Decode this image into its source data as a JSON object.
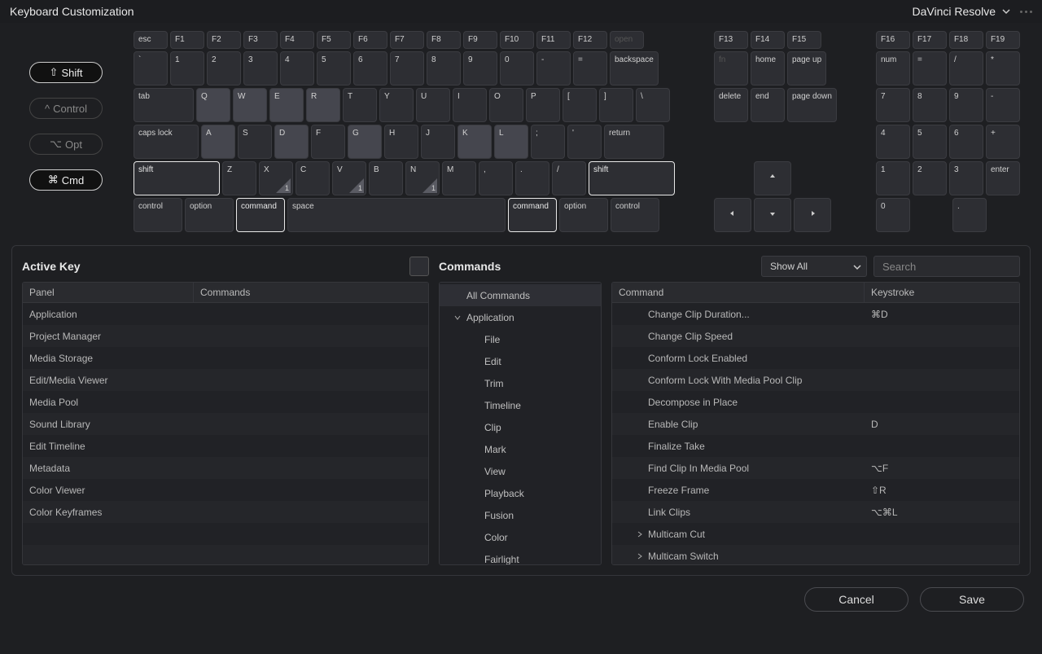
{
  "title": "Keyboard Customization",
  "preset": "DaVinci Resolve",
  "modifiers": [
    {
      "symbol": "⇧",
      "label": "Shift",
      "active": true
    },
    {
      "symbol": "^",
      "label": "Control",
      "active": false
    },
    {
      "symbol": "⌥",
      "label": "Opt",
      "active": false
    },
    {
      "symbol": "⌘",
      "label": "Cmd",
      "active": true
    }
  ],
  "keyboard": {
    "fn_row": [
      "esc",
      "F1",
      "F2",
      "F3",
      "F4",
      "F5",
      "F6",
      "F7",
      "F8",
      "F9",
      "F10",
      "F11",
      "F12"
    ],
    "open_key": "open",
    "num_row": [
      "`",
      "1",
      "2",
      "3",
      "4",
      "5",
      "6",
      "7",
      "8",
      "9",
      "0",
      "-",
      "=",
      "backspace"
    ],
    "q_row": [
      "tab",
      "Q",
      "W",
      "E",
      "R",
      "T",
      "Y",
      "U",
      "I",
      "O",
      "P",
      "[",
      "]",
      "\\"
    ],
    "a_row": [
      "caps lock",
      "A",
      "S",
      "D",
      "F",
      "G",
      "H",
      "J",
      "K",
      "L",
      ";",
      "'",
      "return"
    ],
    "z_row": [
      "shift",
      "Z",
      "X",
      "C",
      "V",
      "B",
      "N",
      "M",
      ",",
      ".",
      "/",
      "shift"
    ],
    "bottom_row": [
      "control",
      "option",
      "command",
      "space",
      "command",
      "option",
      "control"
    ],
    "nav_top": [
      "F13",
      "F14",
      "F15"
    ],
    "nav_mid1": [
      "fn",
      "home",
      "page up"
    ],
    "nav_mid2": [
      "delete",
      "end",
      "page down"
    ],
    "numpad_top": [
      "F16",
      "F17",
      "F18",
      "F19"
    ],
    "numpad_r1": [
      "num",
      "=",
      "/",
      "*"
    ],
    "numpad_r2": [
      "7",
      "8",
      "9",
      "-"
    ],
    "numpad_r3": [
      "4",
      "5",
      "6",
      "+"
    ],
    "numpad_r4": [
      "1",
      "2",
      "3",
      "enter"
    ],
    "numpad_r5": [
      "0",
      "."
    ]
  },
  "active_key": {
    "title": "Active Key",
    "headers": [
      "Panel",
      "Commands"
    ],
    "rows": [
      [
        "Application",
        ""
      ],
      [
        "Project Manager",
        ""
      ],
      [
        "Media Storage",
        ""
      ],
      [
        "Edit/Media Viewer",
        ""
      ],
      [
        "Media Pool",
        ""
      ],
      [
        "Sound Library",
        ""
      ],
      [
        "Edit Timeline",
        ""
      ],
      [
        "Metadata",
        ""
      ],
      [
        "Color Viewer",
        ""
      ],
      [
        "Color Keyframes",
        ""
      ]
    ]
  },
  "commands_tree": {
    "title": "Commands",
    "filter": "Show All",
    "search_placeholder": "Search",
    "items": [
      {
        "label": "All Commands",
        "depth": 0,
        "selected": true
      },
      {
        "label": "Application",
        "depth": 0,
        "expanded": true
      },
      {
        "label": "File",
        "depth": 1
      },
      {
        "label": "Edit",
        "depth": 1
      },
      {
        "label": "Trim",
        "depth": 1
      },
      {
        "label": "Timeline",
        "depth": 1
      },
      {
        "label": "Clip",
        "depth": 1
      },
      {
        "label": "Mark",
        "depth": 1
      },
      {
        "label": "View",
        "depth": 1
      },
      {
        "label": "Playback",
        "depth": 1
      },
      {
        "label": "Fusion",
        "depth": 1
      },
      {
        "label": "Color",
        "depth": 1
      },
      {
        "label": "Fairlight",
        "depth": 1
      }
    ]
  },
  "command_list": {
    "headers": [
      "Command",
      "Keystroke"
    ],
    "rows": [
      [
        "Change Clip Duration...",
        "⌘D",
        ""
      ],
      [
        "Change Clip Speed",
        "",
        ""
      ],
      [
        "Conform Lock Enabled",
        "",
        ""
      ],
      [
        "Conform Lock With Media Pool Clip",
        "",
        ""
      ],
      [
        "Decompose in Place",
        "",
        ""
      ],
      [
        "Enable Clip",
        "D",
        ""
      ],
      [
        "Finalize Take",
        "",
        ""
      ],
      [
        "Find Clip In Media Pool",
        "⌥F",
        ""
      ],
      [
        "Freeze Frame",
        "⇧R",
        ""
      ],
      [
        "Link Clips",
        "⌥⌘L",
        ""
      ],
      [
        "Multicam Cut",
        "",
        ">"
      ],
      [
        "Multicam Switch",
        "",
        ">"
      ]
    ]
  },
  "footer": {
    "cancel": "Cancel",
    "save": "Save"
  }
}
